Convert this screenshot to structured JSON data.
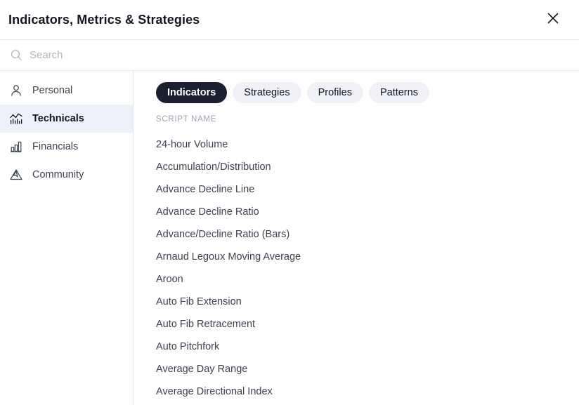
{
  "header": {
    "title": "Indicators, Metrics & Strategies",
    "close_icon": "close-icon"
  },
  "search": {
    "icon": "search-icon",
    "value": "",
    "placeholder": "Search"
  },
  "sidebar": {
    "items": [
      {
        "label": "Personal",
        "icon": "person-icon",
        "active": false
      },
      {
        "label": "Technicals",
        "icon": "chart-line-bars-icon",
        "active": true
      },
      {
        "label": "Financials",
        "icon": "bar-chart-icon",
        "active": false
      },
      {
        "label": "Community",
        "icon": "mountain-icon",
        "active": false
      }
    ]
  },
  "main": {
    "tabs": [
      {
        "label": "Indicators",
        "active": true
      },
      {
        "label": "Strategies",
        "active": false
      },
      {
        "label": "Profiles",
        "active": false
      },
      {
        "label": "Patterns",
        "active": false
      }
    ],
    "column_header": "SCRIPT NAME",
    "scripts": [
      "24-hour Volume",
      "Accumulation/Distribution",
      "Advance Decline Line",
      "Advance Decline Ratio",
      "Advance/Decline Ratio (Bars)",
      "Arnaud Legoux Moving Average",
      "Aroon",
      "Auto Fib Extension",
      "Auto Fib Retracement",
      "Auto Pitchfork",
      "Average Day Range",
      "Average Directional Index"
    ]
  },
  "colors": {
    "accent_dark": "#1b2030",
    "tab_inactive_bg": "#eff1f7",
    "sidebar_active_bg": "#eef1f9",
    "text_primary": "#131722",
    "text_secondary": "#3c4251",
    "text_muted": "#9ca3b0",
    "placeholder": "#b2b5be",
    "divider": "#e6e8ef"
  }
}
